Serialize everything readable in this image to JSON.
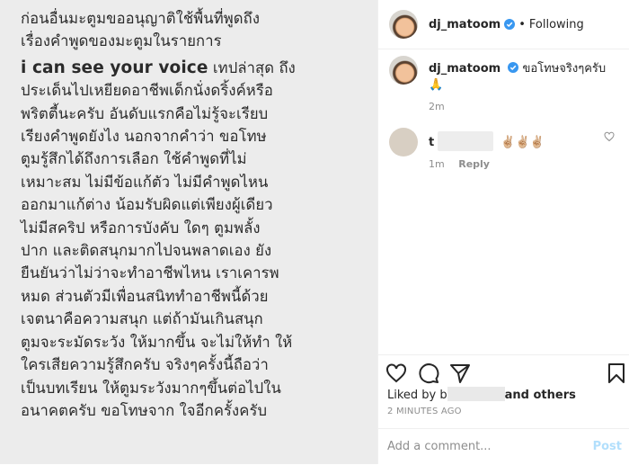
{
  "story": {
    "lines": [
      "ก่อนอื่นมะตูมขออนุญาติใช้พื้นที่พูดถึง",
      "เรื่องคำพูดของมะตูมในรายการ",
      "i can see your voice",
      "เทปล่าสุด ถึง",
      "ประเด็นไปเหยียดอาชีพเด็กนั่งดริ้งค์หรือ",
      "พริตตี้นะครับ อันดับแรกคือไม่รู้จะเรียบ",
      "เรียงคำพูดยังไง นอกจากคำว่า ขอโทษ",
      "ตูมรู้สึกได้ถึงการเลือก ใช้คำพูดที่ไม่",
      "เหมาะสม ไม่มีข้อแก้ตัว ไม่มีคำพูดไหน",
      "ออกมาแก้ต่าง น้อมรับผิดแต่เพียงผู้เดียว",
      "ไม่มีสคริป หรือการบังคับ ใดๆ ตูมพลั้ง",
      "ปาก และติดสนุกมากไปจนพลาดเอง ยัง",
      "ยืนยันว่าไม่ว่าจะทำอาชีพไหน เราเคารพ",
      "หมด ส่วนตัวมีเพื่อนสนิททำอาชีพนี้ด้วย",
      "เจตนาคือความสนุก แต่ถ้ามันเกินสนุก",
      "ตูมจะระมัดระวัง ให้มากขึ้น จะไม่ให้ทำ ให้",
      "ใครเสียความรู้สึกครับ จริงๆครั้งนี้ถือว่า",
      "เป็นบทเรียน ให้ตูมระวังมากๆขึ้นต่อไปใน",
      "อนาคตครับ ขอโทษจาก ใจอีกครั้งครับ"
    ]
  },
  "header": {
    "username": "dj_matoom",
    "separator": "•",
    "follow_label": "Following"
  },
  "caption": {
    "username": "dj_matoom",
    "text": "ขอโทษจริงๆครับ 🙏",
    "age": "2m"
  },
  "comment": {
    "username_prefix": "t",
    "text": "✌🏼✌🏼✌🏼",
    "age": "1m",
    "reply_label": "Reply"
  },
  "likes": {
    "prefix": "Liked by b",
    "suffix": "and others"
  },
  "timestamp": "2 MINUTES AGO",
  "add_comment": {
    "placeholder": "Add a comment...",
    "post_label": "Post"
  },
  "colors": {
    "verified": "#3897f0",
    "post_disabled": "#b2dffc"
  }
}
